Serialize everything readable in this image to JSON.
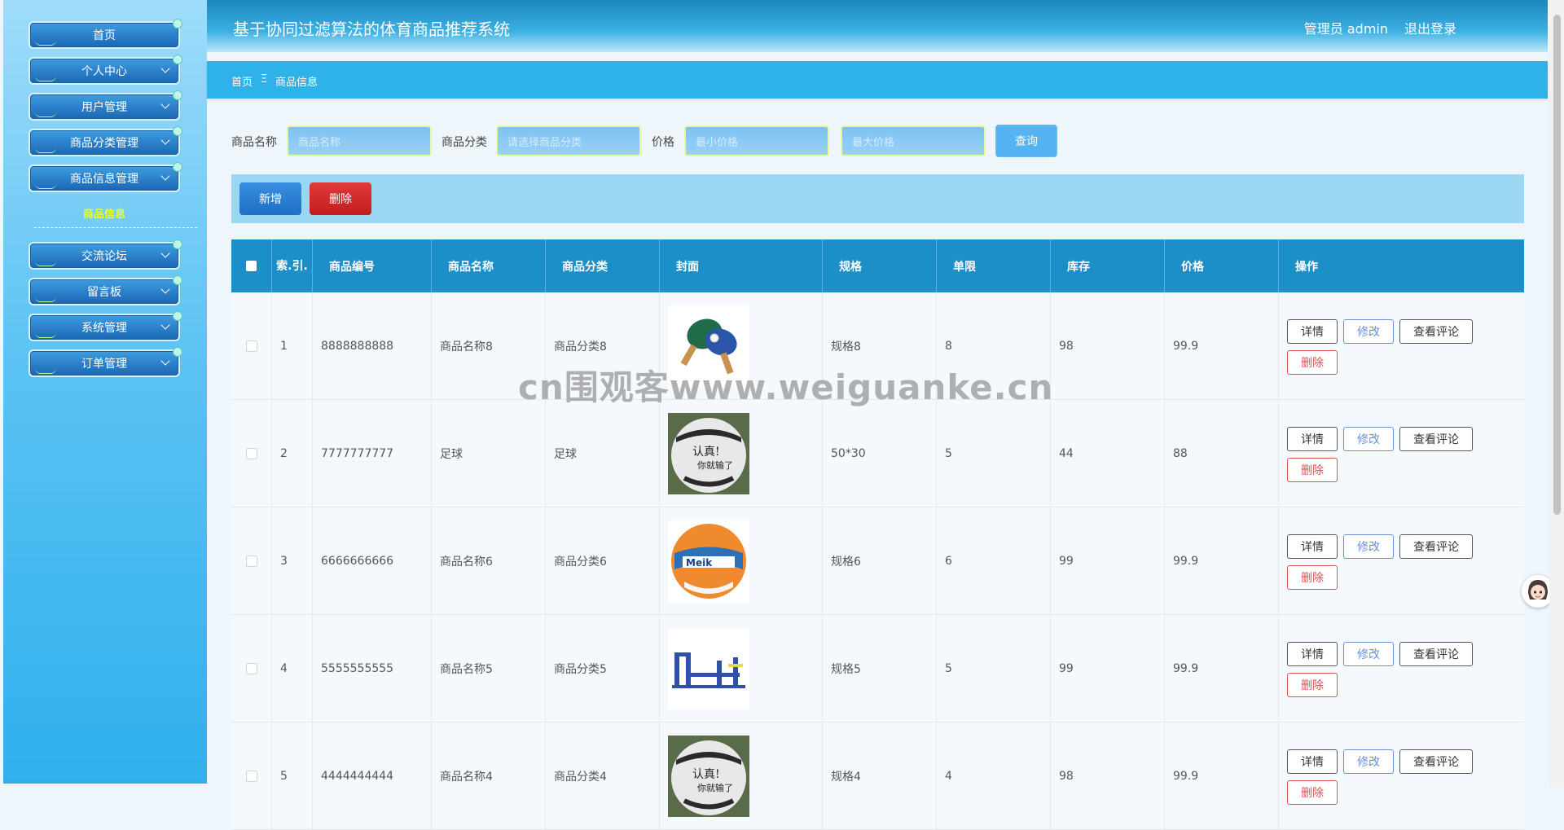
{
  "app": {
    "title": "基于协同过滤算法的体育商品推荐系统"
  },
  "header": {
    "user_info": "管理员 admin",
    "logout": "退出登录"
  },
  "sidebar": {
    "items": [
      {
        "label": "首页"
      },
      {
        "label": "个人中心"
      },
      {
        "label": "用户管理"
      },
      {
        "label": "商品分类管理"
      },
      {
        "label": "商品信息管理"
      },
      {
        "label": "交流论坛"
      },
      {
        "label": "留言板"
      },
      {
        "label": "系统管理"
      },
      {
        "label": "订单管理"
      }
    ],
    "sub_item": "商品信息"
  },
  "breadcrumb": {
    "home": "首页",
    "sep": "Ξ",
    "current": "商品信息"
  },
  "search": {
    "name_label": "商品名称",
    "name_placeholder": "商品名称",
    "category_label": "商品分类",
    "category_placeholder": "请选择商品分类",
    "price_label": "价格",
    "price_min_placeholder": "最小价格",
    "price_max_placeholder": "最大价格",
    "query_label": "查询"
  },
  "actions": {
    "add_label": "新增",
    "delete_label": "删除"
  },
  "table": {
    "headers": [
      "索.引.",
      "商品编号",
      "商品名称",
      "商品分类",
      "封面",
      "规格",
      "单限",
      "库存",
      "价格",
      "操作"
    ],
    "rows": [
      {
        "index": "1",
        "code": "8888888888",
        "name": "商品名称8",
        "category": "商品分类8",
        "cover": "table-tennis-icon",
        "spec": "规格8",
        "limit": "8",
        "stock": "98",
        "price": "99.9"
      },
      {
        "index": "2",
        "code": "7777777777",
        "name": "足球",
        "category": "足球",
        "cover": "ball-icon",
        "spec": "50*30",
        "limit": "5",
        "stock": "44",
        "price": "88"
      },
      {
        "index": "3",
        "code": "6666666666",
        "name": "商品名称6",
        "category": "商品分类6",
        "cover": "volleyball-icon",
        "spec": "规格6",
        "limit": "6",
        "stock": "99",
        "price": "99.9"
      },
      {
        "index": "4",
        "code": "5555555555",
        "name": "商品名称5",
        "category": "商品分类5",
        "cover": "fitness-equipment-icon",
        "spec": "规格5",
        "limit": "5",
        "stock": "99",
        "price": "99.9"
      },
      {
        "index": "5",
        "code": "4444444444",
        "name": "商品名称4",
        "category": "商品分类4",
        "cover": "ball-icon",
        "spec": "规格4",
        "limit": "4",
        "stock": "98",
        "price": "99.9"
      }
    ],
    "ops": {
      "detail": "详情",
      "edit": "修改",
      "review": "查看评论",
      "delete": "删除"
    }
  },
  "watermark": "cn围观客www.weiguanke.cn",
  "colors": {
    "header": "#1c86bf",
    "table_header": "#1c8ec8",
    "accent": "#2fb2ea",
    "danger": "#d42525"
  }
}
